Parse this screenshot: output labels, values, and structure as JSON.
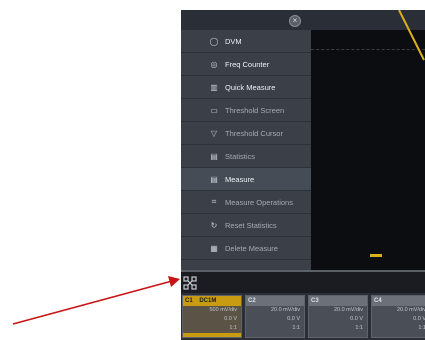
{
  "menu": {
    "items": [
      {
        "label": "DVM",
        "icon": "circle-icon"
      },
      {
        "label": "Freq Counter",
        "icon": "gauge-icon"
      },
      {
        "label": "Quick Measure",
        "icon": "bars-icon"
      },
      {
        "label": "Threshold Screen",
        "icon": "monitor-icon"
      },
      {
        "label": "Threshold Cursor",
        "icon": "cursor-icon"
      },
      {
        "label": "Statistics",
        "icon": "table-icon"
      },
      {
        "label": "Measure",
        "icon": "table-icon"
      },
      {
        "label": "Measure Operations",
        "icon": "brackets-icon"
      },
      {
        "label": "Reset Statistics",
        "icon": "refresh-icon"
      },
      {
        "label": "Delete Measure",
        "icon": "delete-icon"
      }
    ]
  },
  "channels": [
    {
      "name": "C1",
      "tag": "DC1M",
      "lines": [
        "500 mV/div",
        "0.0 V",
        "1:1"
      ]
    },
    {
      "name": "C2",
      "tag": "",
      "lines": [
        "20.0 mV/div",
        "0.0 V",
        "1:1"
      ]
    },
    {
      "name": "C3",
      "tag": "",
      "lines": [
        "20.0 mV/div",
        "0.0 V",
        "1:1"
      ]
    },
    {
      "name": "C4",
      "tag": "",
      "lines": [
        "20.0 mV/div",
        "0.0 V",
        "1:1"
      ]
    }
  ],
  "colors": {
    "trace": "#d9b01c",
    "annotation_arrow": "#c81414"
  }
}
